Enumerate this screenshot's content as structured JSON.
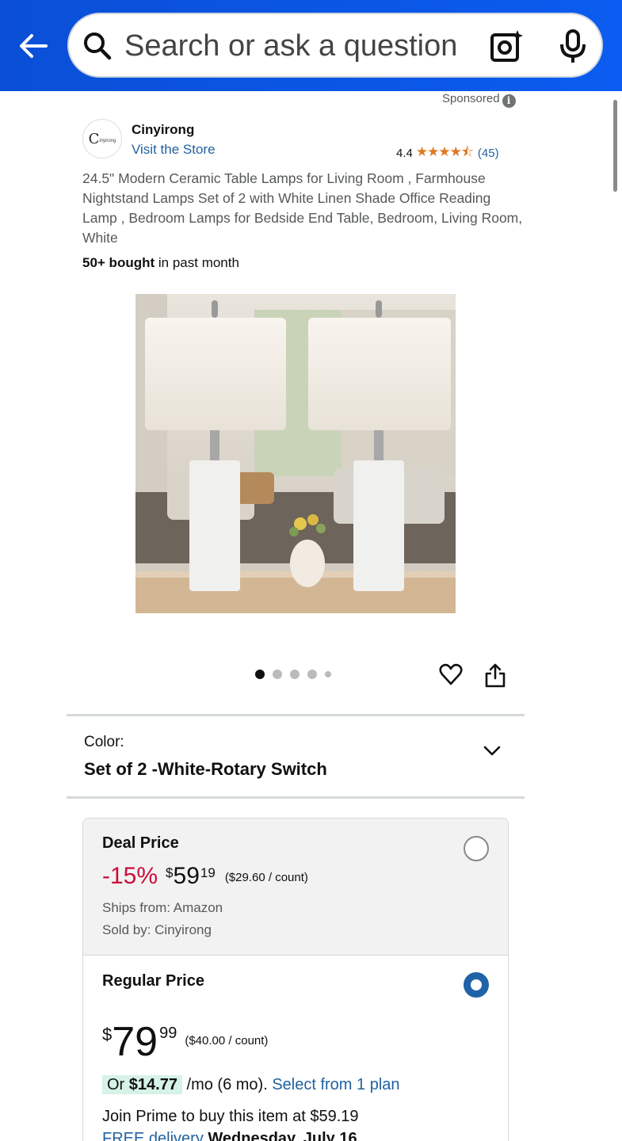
{
  "search": {
    "placeholder": "Search or ask a question"
  },
  "sponsored_label": "Sponsored",
  "brand": {
    "name": "Cinyirong",
    "logo_big": "C",
    "logo_small": "inyirong",
    "visit_store": "Visit the Store"
  },
  "rating": {
    "value": "4.4",
    "stars_display": "★★★★⯪",
    "count": "(45)"
  },
  "product": {
    "title": "24.5\" Modern Ceramic Table Lamps for Living Room , Farmhouse Nightstand Lamps Set of 2 with White Linen Shade Office Reading Lamp ,   Bedroom Lamps for Bedside End Table, Bedroom, Living Room, White",
    "bought_bold": "50+ bought",
    "bought_rest": " in past month"
  },
  "carousel": {
    "total": 5,
    "active": 1
  },
  "color": {
    "label": "Color:",
    "value": "Set of 2 -White-Rotary Switch"
  },
  "deal": {
    "label": "Deal Price",
    "discount": "-15%",
    "currency": "$",
    "whole": "59",
    "fraction": "19",
    "per_count": "($29.60 / count)",
    "ships": "Ships from: Amazon",
    "sold": "Sold by: Cinyirong"
  },
  "regular": {
    "label": "Regular Price",
    "currency": "$",
    "whole": "79",
    "fraction": "99",
    "per_count": "($40.00 / count)",
    "monthly_prefix": "Or ",
    "monthly_amount": "$14.77",
    "monthly_suffix": " /mo (6 mo). ",
    "plan_link": "Select from 1 plan",
    "prime": "Join Prime to buy this item at $59.19",
    "delivery_free": "FREE delivery",
    "delivery_date": " Wednesday, July 16"
  },
  "colors": {
    "header": "#0b55e4",
    "link": "#2162a1",
    "discount": "#cc0c39",
    "star": "#de7921",
    "radio_selected": "#1f63a6"
  }
}
